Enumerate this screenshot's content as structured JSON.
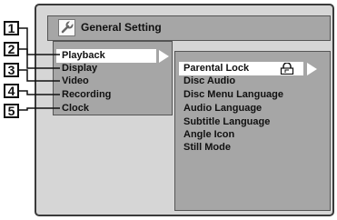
{
  "window": {
    "title": "General Setting",
    "icon": "wrench-icon"
  },
  "main_menu": {
    "items": [
      {
        "label": "Playback",
        "selected": true
      },
      {
        "label": "Display"
      },
      {
        "label": "Video"
      },
      {
        "label": "Recording"
      },
      {
        "label": "Clock"
      }
    ]
  },
  "sub_menu": {
    "items": [
      {
        "label": "Parental Lock",
        "selected": true,
        "icon": "lock-icon"
      },
      {
        "label": "Disc Audio"
      },
      {
        "label": "Disc Menu Language"
      },
      {
        "label": "Audio Language"
      },
      {
        "label": "Subtitle Language"
      },
      {
        "label": "Angle Icon"
      },
      {
        "label": "Still Mode"
      }
    ]
  },
  "callouts": [
    "1",
    "2",
    "3",
    "4",
    "5"
  ],
  "colors": {
    "panel": "#a6a6a6",
    "frame": "#d6d6d6",
    "highlight": "#ffffff"
  }
}
